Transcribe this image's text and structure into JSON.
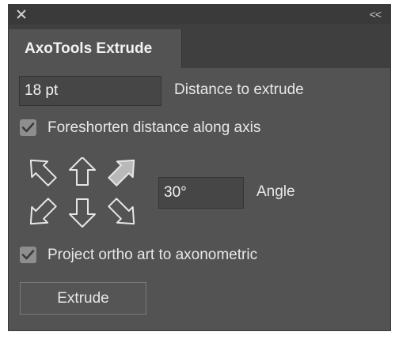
{
  "window": {
    "close_icon": "close-icon",
    "collapse_label": "<<"
  },
  "tab": {
    "title": "AxoTools Extrude"
  },
  "distance": {
    "value": "18 pt",
    "label": "Distance to extrude"
  },
  "foreshorten": {
    "checked": true,
    "label": "Foreshorten distance along axis"
  },
  "direction": {
    "icons": [
      "arrow-up-left-icon",
      "arrow-up-icon",
      "arrow-up-right-icon",
      "arrow-down-left-icon",
      "arrow-down-icon",
      "arrow-down-right-icon"
    ],
    "selected": "arrow-up-right-icon"
  },
  "angle": {
    "value": "30°",
    "label": "Angle"
  },
  "project": {
    "checked": true,
    "label": "Project ortho art to axonometric"
  },
  "extrude_button": {
    "label": "Extrude"
  },
  "colors": {
    "panel": "#535353",
    "titlebar": "#3a3a3a",
    "field": "#464646",
    "checkbox": "#8e8e8e",
    "arrow_selected": "#b9b9b9"
  }
}
